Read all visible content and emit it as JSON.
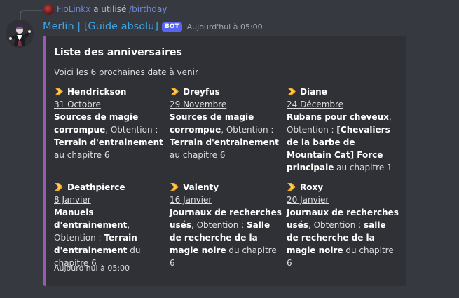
{
  "reply": {
    "user": "FioLinkx",
    "middle": " a utilisé ",
    "command": "/birthday"
  },
  "message": {
    "author": "Merlin | [Guide absolu]",
    "bot_tag": "BOT",
    "timestamp": "Aujourd'hui à 05:00"
  },
  "embed": {
    "accent_color": "#9b59b6",
    "title": "Liste des anniversaires",
    "description": "Voici les 6 prochaines date à venir",
    "fields": [
      {
        "name": "Hendrickson",
        "date": "31 Octobre",
        "parts": [
          {
            "text": "Sources de magie corrompue",
            "bold": true
          },
          {
            "text": ", Obtention : ",
            "bold": false
          },
          {
            "text": "Terrain d'entrainement",
            "bold": true
          },
          {
            "text": " au chapitre 6",
            "bold": false
          }
        ]
      },
      {
        "name": "Dreyfus",
        "date": "29 Novembre",
        "parts": [
          {
            "text": "Sources de magie corrompue",
            "bold": true
          },
          {
            "text": ", Obtention : ",
            "bold": false
          },
          {
            "text": "Terrain d'entrainement",
            "bold": true
          },
          {
            "text": " au chapitre 6",
            "bold": false
          }
        ]
      },
      {
        "name": "Diane",
        "date": "24 Décembre",
        "parts": [
          {
            "text": "Rubans pour cheveux",
            "bold": true
          },
          {
            "text": ", Obtention : ",
            "bold": false
          },
          {
            "text": "[Chevaliers de la barbe de Mountain Cat] Force principale",
            "bold": true
          },
          {
            "text": " au chapitre 1",
            "bold": false
          }
        ]
      },
      {
        "name": "Deathpierce",
        "date": "8 Janvier",
        "parts": [
          {
            "text": "Manuels d'entrainement",
            "bold": true
          },
          {
            "text": ", Obtention : ",
            "bold": false
          },
          {
            "text": "Terrain d'entrainement",
            "bold": true
          },
          {
            "text": " du chapitre 6",
            "bold": false
          }
        ]
      },
      {
        "name": "Valenty",
        "date": "16 Janvier",
        "parts": [
          {
            "text": "Journaux de recherches usés",
            "bold": true
          },
          {
            "text": ", Obtention : ",
            "bold": false
          },
          {
            "text": "Salle de recherche de la magie noire",
            "bold": true
          },
          {
            "text": " du chapitre 6",
            "bold": false
          }
        ]
      },
      {
        "name": "Roxy",
        "date": "20 Janvier",
        "parts": [
          {
            "text": "Journaux de recherches usés",
            "bold": true
          },
          {
            "text": ", Obtention : ",
            "bold": false
          },
          {
            "text": "salle de recherche de la magie noire",
            "bold": true
          },
          {
            "text": " du chapitre 6",
            "bold": false
          }
        ]
      }
    ],
    "footer": "Aujourd'hui à 05:00"
  },
  "icons": {
    "field_icon": "arrow-right-emoji-icon",
    "avatar": "bot-avatar-icon"
  }
}
